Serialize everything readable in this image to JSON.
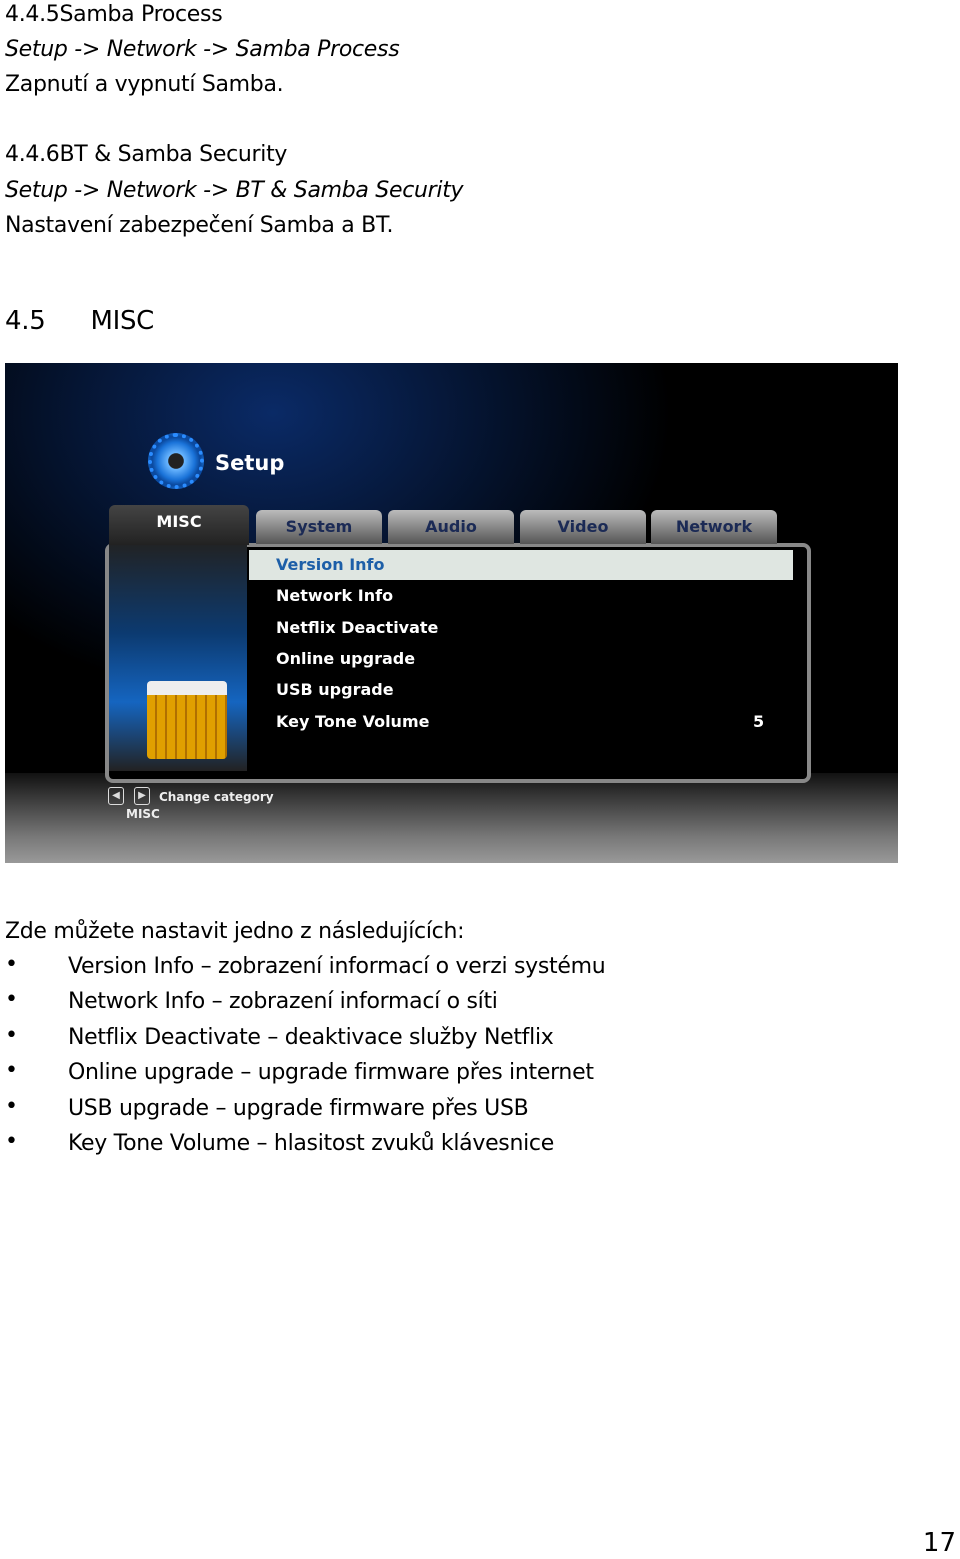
{
  "sections": [
    {
      "heading": "4.4.5Samba Process",
      "path": "Setup -> Network -> Samba Process",
      "desc": "Zapnutí a vypnutí Samba."
    },
    {
      "heading": "4.4.6BT & Samba Security",
      "path": "Setup -> Network -> BT & Samba Security",
      "desc": "Nastavení zabezpečení Samba a BT."
    }
  ],
  "misc_heading": {
    "number": "4.5",
    "title": "MISC"
  },
  "screen": {
    "title": "Setup",
    "tabs": [
      "MISC",
      "System",
      "Audio",
      "Video",
      "Network"
    ],
    "active_tab": "MISC",
    "menu": [
      {
        "label": "Version Info",
        "value": ""
      },
      {
        "label": "Network Info",
        "value": ""
      },
      {
        "label": "Netflix Deactivate",
        "value": ""
      },
      {
        "label": "Online upgrade",
        "value": ""
      },
      {
        "label": "USB upgrade",
        "value": ""
      },
      {
        "label": "Key Tone Volume",
        "value": "5"
      }
    ],
    "selected_index": 0,
    "hint": "Change category",
    "category": "MISC",
    "accent": "#1d5fa8"
  },
  "intro": "Zde můžete nastavit jedno z následujících:",
  "bullets": [
    "Version Info – zobrazení informací o verzi systému",
    "Network Info – zobrazení informací o síti",
    "Netflix Deactivate – deaktivace služby Netflix",
    "Online upgrade – upgrade firmware přes internet",
    "USB upgrade – upgrade firmware přes USB",
    "Key Tone Volume – hlasitost zvuků klávesnice"
  ],
  "page_number": "17"
}
